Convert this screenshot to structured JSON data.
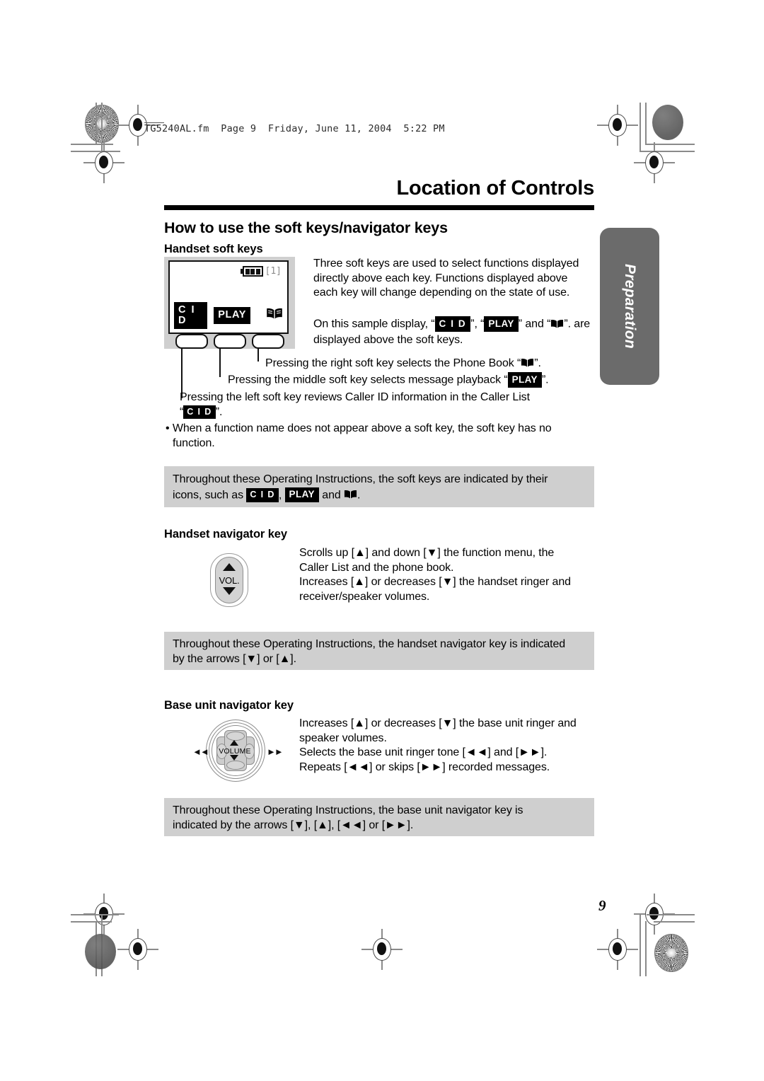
{
  "header": {
    "slug": "TG5240AL.fm  Page 9  Friday, June 11, 2004  5:22 PM"
  },
  "chapter": {
    "title": "Location of Controls"
  },
  "side_tab": {
    "label": "Preparation"
  },
  "section": {
    "heading": "How to use the soft keys/navigator keys"
  },
  "handset_soft_keys": {
    "heading": "Handset soft keys",
    "figure": {
      "battery_indicator": "[1]",
      "battery_segments": 3,
      "soft_key_labels": [
        "C I D",
        "PLAY",
        "book-icon"
      ]
    },
    "para1": "Three soft keys are used to select functions displayed directly above each key. Functions displayed above each key will change depending on the state of use.",
    "para2_a": "On this sample display, “",
    "para2_key1": "C I D",
    "para2_b": "”, “",
    "para2_key2": "PLAY",
    "para2_c": "” and “",
    "para2_d": "”.",
    "para2_e": "are displayed above the soft keys.",
    "callout_right_a": "Pressing the right soft key selects the Phone Book “",
    "callout_right_b": "”.",
    "callout_middle_a": "Pressing the middle soft key selects message playback “",
    "callout_middle_key": "PLAY",
    "callout_middle_b": "”.",
    "callout_left_a": "Pressing the left soft key reviews Caller ID information in the Caller List",
    "callout_left_quote_open": "“",
    "callout_left_key": "C I D",
    "callout_left_b": "”.",
    "bullet": "• When a function name does not appear above a soft key, the soft key has no function."
  },
  "note_soft_keys": {
    "line1": "Throughout these Operating Instructions, the soft keys are indicated by their",
    "line2_a": "icons, such as",
    "line2_key1": "C I D",
    "line2_comma": ",",
    "line2_key2": "PLAY",
    "line2_b": "and",
    "line2_end": "."
  },
  "handset_navigator": {
    "heading": "Handset navigator key",
    "key_label": "VOL.",
    "para_line1": "Scrolls up [▲] and down [▼] the function menu, the",
    "para_line2": "Caller List and the phone book.",
    "para_line3": "Increases [▲] or decreases [▼] the handset ringer and",
    "para_line4": "receiver/speaker volumes."
  },
  "note_handset_navigator": {
    "line1": "Throughout these Operating Instructions, the handset navigator key is indicated",
    "line2": "by the arrows [▼] or [▲]."
  },
  "base_navigator": {
    "heading": "Base unit navigator key",
    "key_label": "VOLUME",
    "left_marker": "◄◄",
    "right_marker": "►►",
    "para_line1": "Increases [▲] or decreases [▼] the base unit ringer and",
    "para_line2": "speaker volumes.",
    "para_line3": "Selects the base unit ringer tone [◄◄] and [►►].",
    "para_line4": "Repeats [◄◄] or skips [►►] recorded messages."
  },
  "note_base_navigator": {
    "line1": "Throughout these Operating Instructions, the base unit navigator key is",
    "line2": "indicated by the arrows [▼], [▲], [◄◄] or [►►]."
  },
  "footer": {
    "page_number": "9"
  },
  "colors": {
    "note_bg": "#cfcfcf",
    "side_tab_bg": "#6b6b6b",
    "key_bg": "#000000",
    "rule": "#000000"
  }
}
